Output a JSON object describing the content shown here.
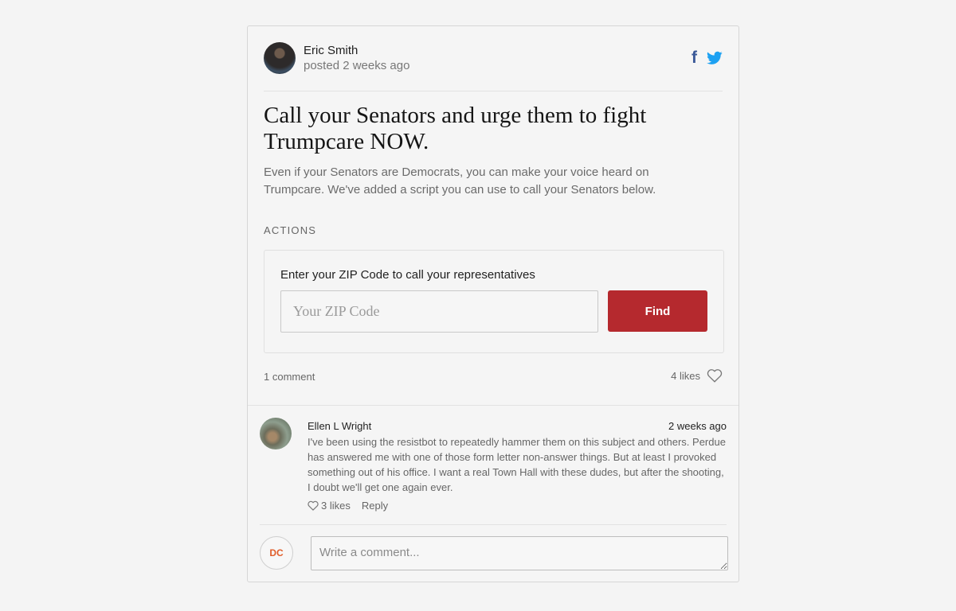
{
  "post": {
    "author": "Eric Smith",
    "meta": "posted 2 weeks ago",
    "title": "Call your Senators and urge them to fight Trumpcare NOW.",
    "description": "Even if your Senators are Democrats, you can make your voice heard on Trumpcare. We've added a script you can use to call your Senators below.",
    "share_icons": [
      "facebook-icon",
      "twitter-icon"
    ]
  },
  "actions": {
    "heading": "ACTIONS",
    "label": "Enter your ZIP Code to call your representatives",
    "zip_placeholder": "Your ZIP Code",
    "zip_value": "",
    "find_label": "Find"
  },
  "footer": {
    "comment_count": "1 comment",
    "likes": "4 likes"
  },
  "comments": [
    {
      "name": "Ellen L Wright",
      "time": "2 weeks ago",
      "body": "I've been using the resistbot to repeatedly hammer them on this subject and others. Perdue has answered me with one of those form letter non-answer things. But at least I provoked something out of his office. I want a real Town Hall with these dudes, but after the shooting, I doubt we'll get one again ever.",
      "likes": "3 likes",
      "reply": "Reply"
    }
  ],
  "new_comment": {
    "initials": "DC",
    "placeholder": "Write a comment..."
  },
  "colors": {
    "accent_button": "#b5292e",
    "facebook": "#3b5998",
    "twitter": "#1da1f2",
    "initials": "#e05d2a"
  }
}
